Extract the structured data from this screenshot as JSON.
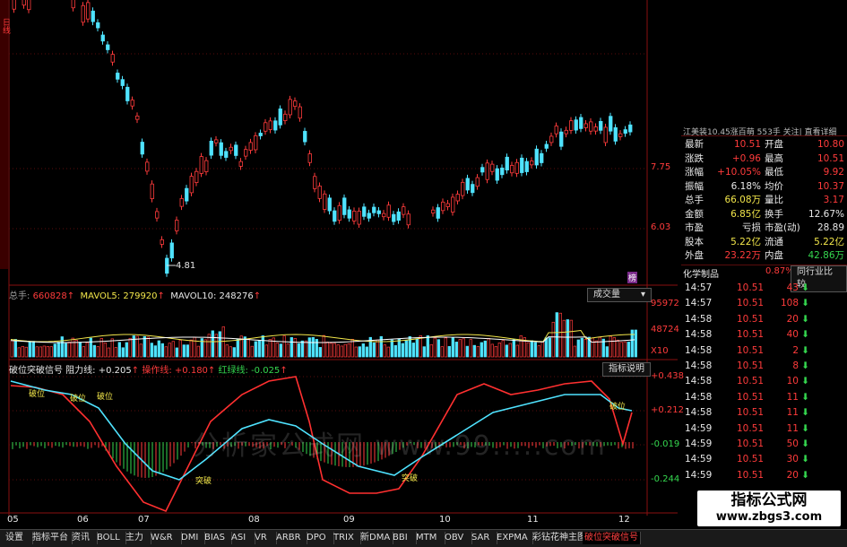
{
  "window": {
    "side_tab_chars": "日线",
    "accent_red": "#ff3b3b",
    "accent_green": "#35d84f",
    "accent_cyan": "#4fe3ff"
  },
  "price_panel": {
    "price_labels": [
      "7.75",
      "6.03"
    ],
    "low_marker": "4.81",
    "extra_marker": "榜"
  },
  "volume_panel": {
    "total_label": "总手:",
    "total_value": "660828",
    "mavol5_label": "MAVOL5:",
    "mavol5_value": "279920",
    "mavol10_label": "MAVOL10:",
    "mavol10_value": "248276",
    "selector_label": "成交量",
    "axis_labels": [
      "95972",
      "48724",
      "X10"
    ]
  },
  "indicator_panel": {
    "name": "破位突破信号",
    "resist_label": "阻力线:",
    "resist_value": "+0.205",
    "op_label": "操作线:",
    "op_value": "+0.180",
    "redgreen_label": "红绿线:",
    "redgreen_value": "-0.025",
    "help_button": "指标说明",
    "axis_labels": [
      "+0.438",
      "+0.212",
      "-0.019",
      "-0.244"
    ],
    "signals": [
      "破位",
      "破位",
      "破位",
      "突破",
      "突破",
      "破位"
    ],
    "watermark": "分析家公式网 www.99.....com"
  },
  "months": [
    "05",
    "06",
    "07",
    "08",
    "09",
    "10",
    "11",
    "12"
  ],
  "right_panel": {
    "header": "江美装10.45涨百萌 553手 关注| 直看详细",
    "quotes": [
      {
        "l1": "最新",
        "v1": "10.51",
        "l2": "开盘",
        "v2": "10.80",
        "c1": "red",
        "c2": "red"
      },
      {
        "l1": "涨跌",
        "v1": "+0.96",
        "l2": "最高",
        "v2": "10.51",
        "c1": "red",
        "c2": "red"
      },
      {
        "l1": "涨幅",
        "v1": "+10.05%",
        "l2": "最低",
        "v2": "9.92",
        "c1": "red",
        "c2": "red"
      },
      {
        "l1": "振幅",
        "v1": "6.18%",
        "l2": "均价",
        "v2": "10.37",
        "c1": "white",
        "c2": "red"
      },
      {
        "l1": "总手",
        "v1": "66.08万",
        "l2": "量比",
        "v2": "3.17",
        "c1": "yellow",
        "c2": "red"
      },
      {
        "l1": "金额",
        "v1": "6.85亿",
        "l2": "换手",
        "v2": "12.67%",
        "c1": "yellow",
        "c2": "white"
      },
      {
        "l1": "市盈",
        "v1": "亏损",
        "l2": "市盈(动)",
        "v2": "28.89",
        "c1": "white",
        "c2": "white"
      },
      {
        "l1": "股本",
        "v1": "5.22亿",
        "l2": "流通",
        "v2": "5.22亿",
        "c1": "yellow",
        "c2": "yellow"
      },
      {
        "l1": "外盘",
        "v1": "23.22万",
        "l2": "内盘",
        "v2": "42.86万",
        "c1": "red",
        "c2": "green"
      }
    ],
    "industry_name": "化学制品",
    "industry_change": "0.87%",
    "compare_button": "同行业比较",
    "ticks": [
      {
        "time": "14:57",
        "price": "10.51",
        "vol": "43"
      },
      {
        "time": "14:57",
        "price": "10.51",
        "vol": "108"
      },
      {
        "time": "14:58",
        "price": "10.51",
        "vol": "20"
      },
      {
        "time": "14:58",
        "price": "10.51",
        "vol": "40"
      },
      {
        "time": "14:58",
        "price": "10.51",
        "vol": "2"
      },
      {
        "time": "14:58",
        "price": "10.51",
        "vol": "8"
      },
      {
        "time": "14:58",
        "price": "10.51",
        "vol": "10"
      },
      {
        "time": "14:58",
        "price": "10.51",
        "vol": "11"
      },
      {
        "time": "14:58",
        "price": "10.51",
        "vol": "11"
      },
      {
        "time": "14:59",
        "price": "10.51",
        "vol": "11"
      },
      {
        "time": "14:59",
        "price": "10.51",
        "vol": "50"
      },
      {
        "time": "14:59",
        "price": "10.51",
        "vol": "30"
      },
      {
        "time": "14:59",
        "price": "10.51",
        "vol": "20"
      }
    ]
  },
  "tabs": [
    "设置",
    "指标平台",
    "资讯",
    "BOLL",
    "主力",
    "W&R",
    "DMI",
    "BIAS",
    "ASI",
    "VR",
    "ARBR",
    "DPO",
    "TRIX",
    "新DMA",
    "BBI",
    "MTM",
    "OBV",
    "SAR",
    "EXPMA",
    "彩钻花神主图",
    "破位突破信号"
  ],
  "brand": {
    "title": "指标公式网",
    "url": "www.zbgs3.com"
  }
}
